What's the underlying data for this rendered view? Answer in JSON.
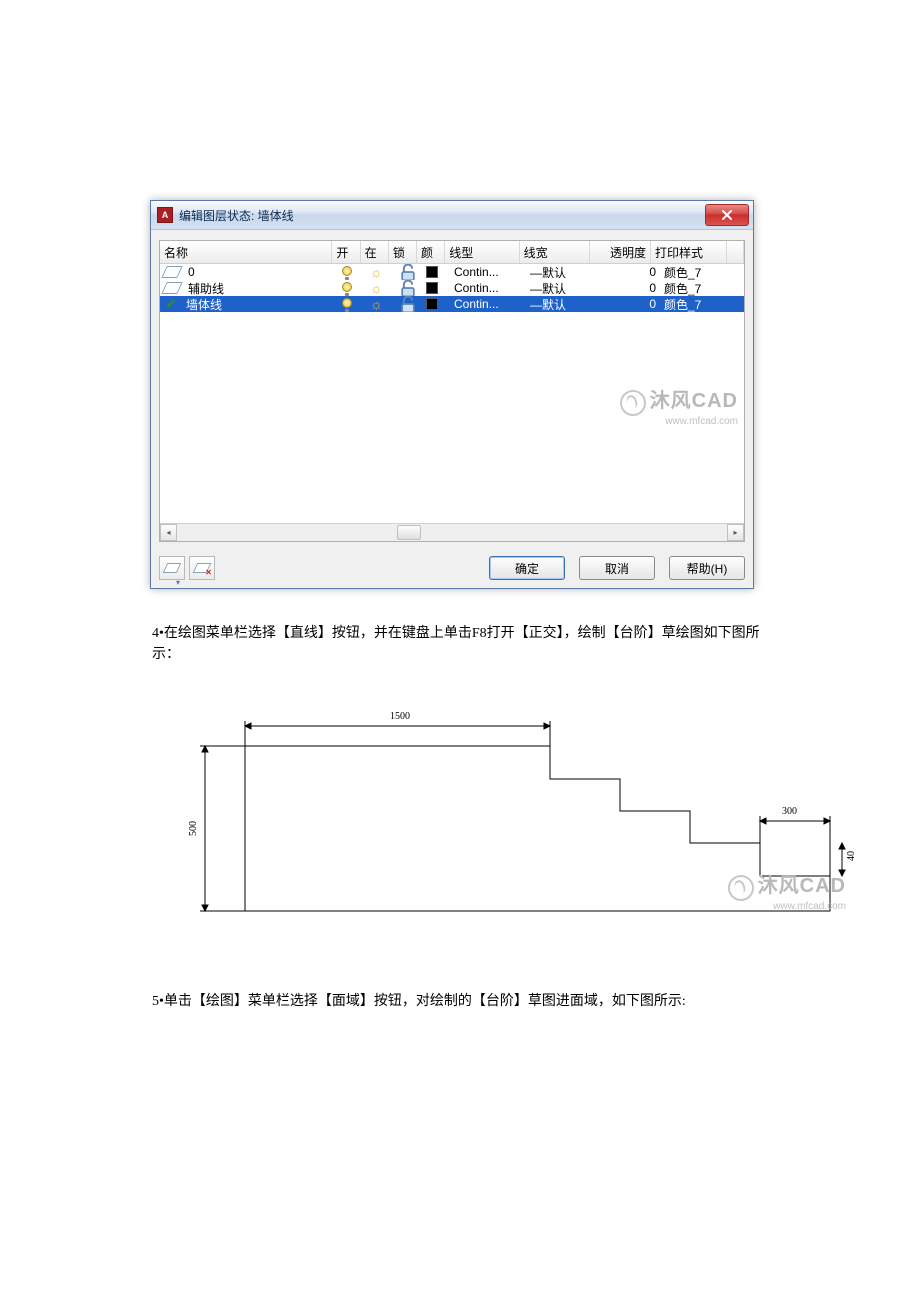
{
  "dialog": {
    "title": "编辑图层状态: 墙体线",
    "columns": {
      "name": "名称",
      "on": "开",
      "freeze": "在",
      "lock": "锁",
      "color": "颜",
      "linetype": "线型",
      "lineweight": "线宽",
      "transparency": "透明度",
      "plotstyle": "打印样式"
    },
    "rows": [
      {
        "name": "0",
        "linetype": "Contin...",
        "lineweight": "—默认",
        "transparency": "0",
        "plotstyle": "颜色_7",
        "selected": false,
        "marker": "layer"
      },
      {
        "name": "辅助线",
        "linetype": "Contin...",
        "lineweight": "—默认",
        "transparency": "0",
        "plotstyle": "颜色_7",
        "selected": false,
        "marker": "layer"
      },
      {
        "name": "墙体线",
        "linetype": "Contin...",
        "lineweight": "—默认",
        "transparency": "0",
        "plotstyle": "颜色_7",
        "selected": true,
        "marker": "check"
      }
    ],
    "buttons": {
      "ok": "确定",
      "cancel": "取消",
      "help": "帮助(H)"
    },
    "watermark": {
      "brand": "沐风CAD",
      "site": "www.mfcad.com"
    }
  },
  "paragraphs": {
    "p4": "4•在绘图菜单栏选择【直线】按钮，并在键盘上单击F8打开【正交】，绘制【台阶】草绘图如下图所示：",
    "p5": "5•单击【绘图】菜单栏选择【面域】按钮，对绘制的【台阶】草图进面域，如下图所示:"
  },
  "diagram": {
    "dim_top": "1500",
    "dim_right": "300",
    "dim_left": "500",
    "dim_far_right": "40",
    "watermark": {
      "brand": "沐风CAD",
      "site": "www.mfcad.com"
    }
  }
}
